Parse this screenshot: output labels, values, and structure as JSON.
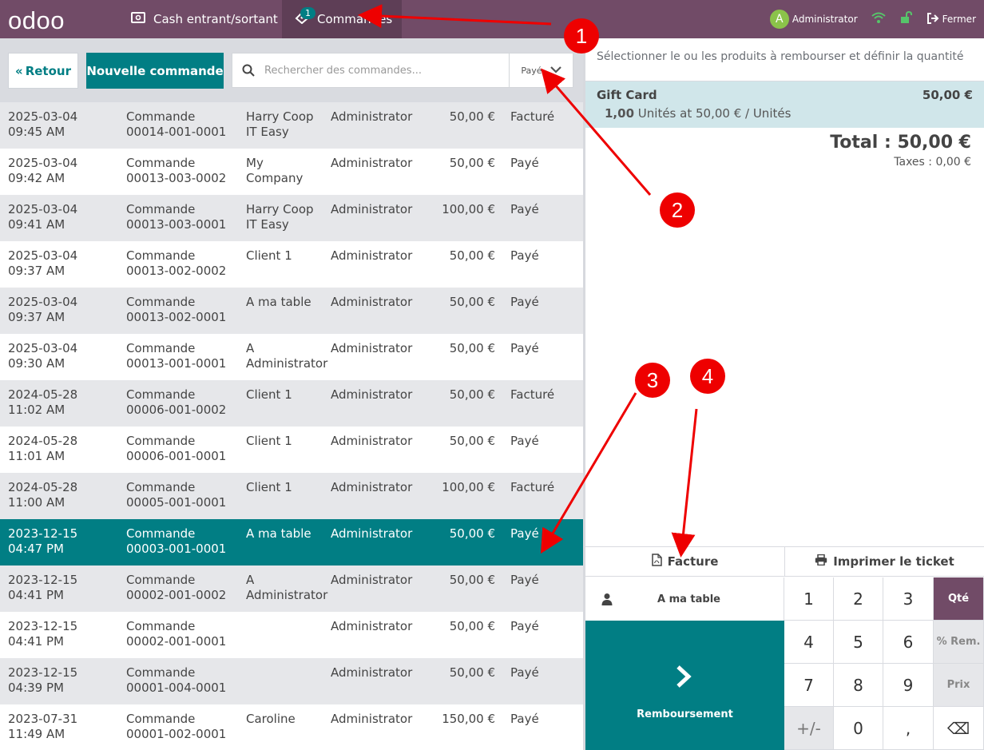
{
  "topbar": {
    "logo": "odoo",
    "nav_cash": "Cash entrant/sortant",
    "nav_orders": "Commandes",
    "orders_badge": "1",
    "user_initial": "A",
    "user_name": "Administrator",
    "close_label": "Fermer"
  },
  "controls": {
    "back_label": "Retour",
    "new_order_label": "Nouvelle commande",
    "search_placeholder": "Rechercher des commandes...",
    "filter_value": "Payé"
  },
  "orders": [
    {
      "date": "2025-03-04",
      "time": "09:45 AM",
      "label": "Commande",
      "number": "00014-001-0001",
      "client_1": "Harry Coop",
      "client_2": "IT Easy",
      "employee": "Administrator",
      "amount": "50,00 €",
      "status": "Facturé"
    },
    {
      "date": "2025-03-04",
      "time": "09:42 AM",
      "label": "Commande",
      "number": "00013-003-0002",
      "client_1": "My",
      "client_2": "Company",
      "employee": "Administrator",
      "amount": "50,00 €",
      "status": "Payé"
    },
    {
      "date": "2025-03-04",
      "time": "09:41 AM",
      "label": "Commande",
      "number": "00013-003-0001",
      "client_1": "Harry Coop",
      "client_2": "IT Easy",
      "employee": "Administrator",
      "amount": "100,00 €",
      "status": "Payé"
    },
    {
      "date": "2025-03-04",
      "time": "09:37 AM",
      "label": "Commande",
      "number": "00013-002-0002",
      "client_1": "Client 1",
      "client_2": "",
      "employee": "Administrator",
      "amount": "50,00 €",
      "status": "Payé"
    },
    {
      "date": "2025-03-04",
      "time": "09:37 AM",
      "label": "Commande",
      "number": "00013-002-0001",
      "client_1": "A ma table",
      "client_2": "",
      "employee": "Administrator",
      "amount": "50,00 €",
      "status": "Payé"
    },
    {
      "date": "2025-03-04",
      "time": "09:30 AM",
      "label": "Commande",
      "number": "00013-001-0001",
      "client_1": "A",
      "client_2": "Administrator",
      "employee": "Administrator",
      "amount": "50,00 €",
      "status": "Payé"
    },
    {
      "date": "2024-05-28",
      "time": "11:02 AM",
      "label": "Commande",
      "number": "00006-001-0002",
      "client_1": "Client 1",
      "client_2": "",
      "employee": "Administrator",
      "amount": "50,00 €",
      "status": "Facturé"
    },
    {
      "date": "2024-05-28",
      "time": "11:01 AM",
      "label": "Commande",
      "number": "00006-001-0001",
      "client_1": "Client 1",
      "client_2": "",
      "employee": "Administrator",
      "amount": "50,00 €",
      "status": "Payé"
    },
    {
      "date": "2024-05-28",
      "time": "11:00 AM",
      "label": "Commande",
      "number": "00005-001-0001",
      "client_1": "Client 1",
      "client_2": "",
      "employee": "Administrator",
      "amount": "100,00 €",
      "status": "Facturé"
    },
    {
      "date": "2023-12-15",
      "time": "04:47 PM",
      "label": "Commande",
      "number": "00003-001-0001",
      "client_1": "A ma table",
      "client_2": "",
      "employee": "Administrator",
      "amount": "50,00 €",
      "status": "Payé"
    },
    {
      "date": "2023-12-15",
      "time": "04:41 PM",
      "label": "Commande",
      "number": "00002-001-0002",
      "client_1": "A",
      "client_2": "Administrator",
      "employee": "Administrator",
      "amount": "50,00 €",
      "status": "Payé"
    },
    {
      "date": "2023-12-15",
      "time": "04:41 PM",
      "label": "Commande",
      "number": "00002-001-0001",
      "client_1": "",
      "client_2": "",
      "employee": "Administrator",
      "amount": "50,00 €",
      "status": "Payé"
    },
    {
      "date": "2023-12-15",
      "time": "04:39 PM",
      "label": "Commande",
      "number": "00001-004-0001",
      "client_1": "",
      "client_2": "",
      "employee": "Administrator",
      "amount": "50,00 €",
      "status": "Payé"
    },
    {
      "date": "2023-07-31",
      "time": "11:49 AM",
      "label": "Commande",
      "number": "00001-002-0001",
      "client_1": "Caroline",
      "client_2": "",
      "employee": "Administrator",
      "amount": "150,00 €",
      "status": "Payé"
    }
  ],
  "selected_order_index": 9,
  "detail": {
    "hint": "Sélectionner le ou les produits à rembourser et définir la quantité",
    "line": {
      "product": "Gift Card",
      "price": "50,00 €",
      "qty": "1,00",
      "unit_detail": "Unités at 50,00 € / Unités"
    },
    "total": "Total : 50,00 €",
    "taxes": "Taxes : 0,00 €",
    "invoice_label": "Facture",
    "print_label": "Imprimer le ticket",
    "customer_label": "A ma table",
    "refund_label": "Remboursement"
  },
  "numpad": {
    "keys": [
      "1",
      "2",
      "3",
      "Qté",
      "4",
      "5",
      "6",
      "% Rem.",
      "7",
      "8",
      "9",
      "Prix",
      "+/-",
      "0",
      ",",
      "⌫"
    ]
  },
  "annotations": [
    "1",
    "2",
    "3",
    "4"
  ],
  "colors": {
    "brand": "#714b67",
    "accent": "#017e84",
    "marker": "#ee0000"
  }
}
